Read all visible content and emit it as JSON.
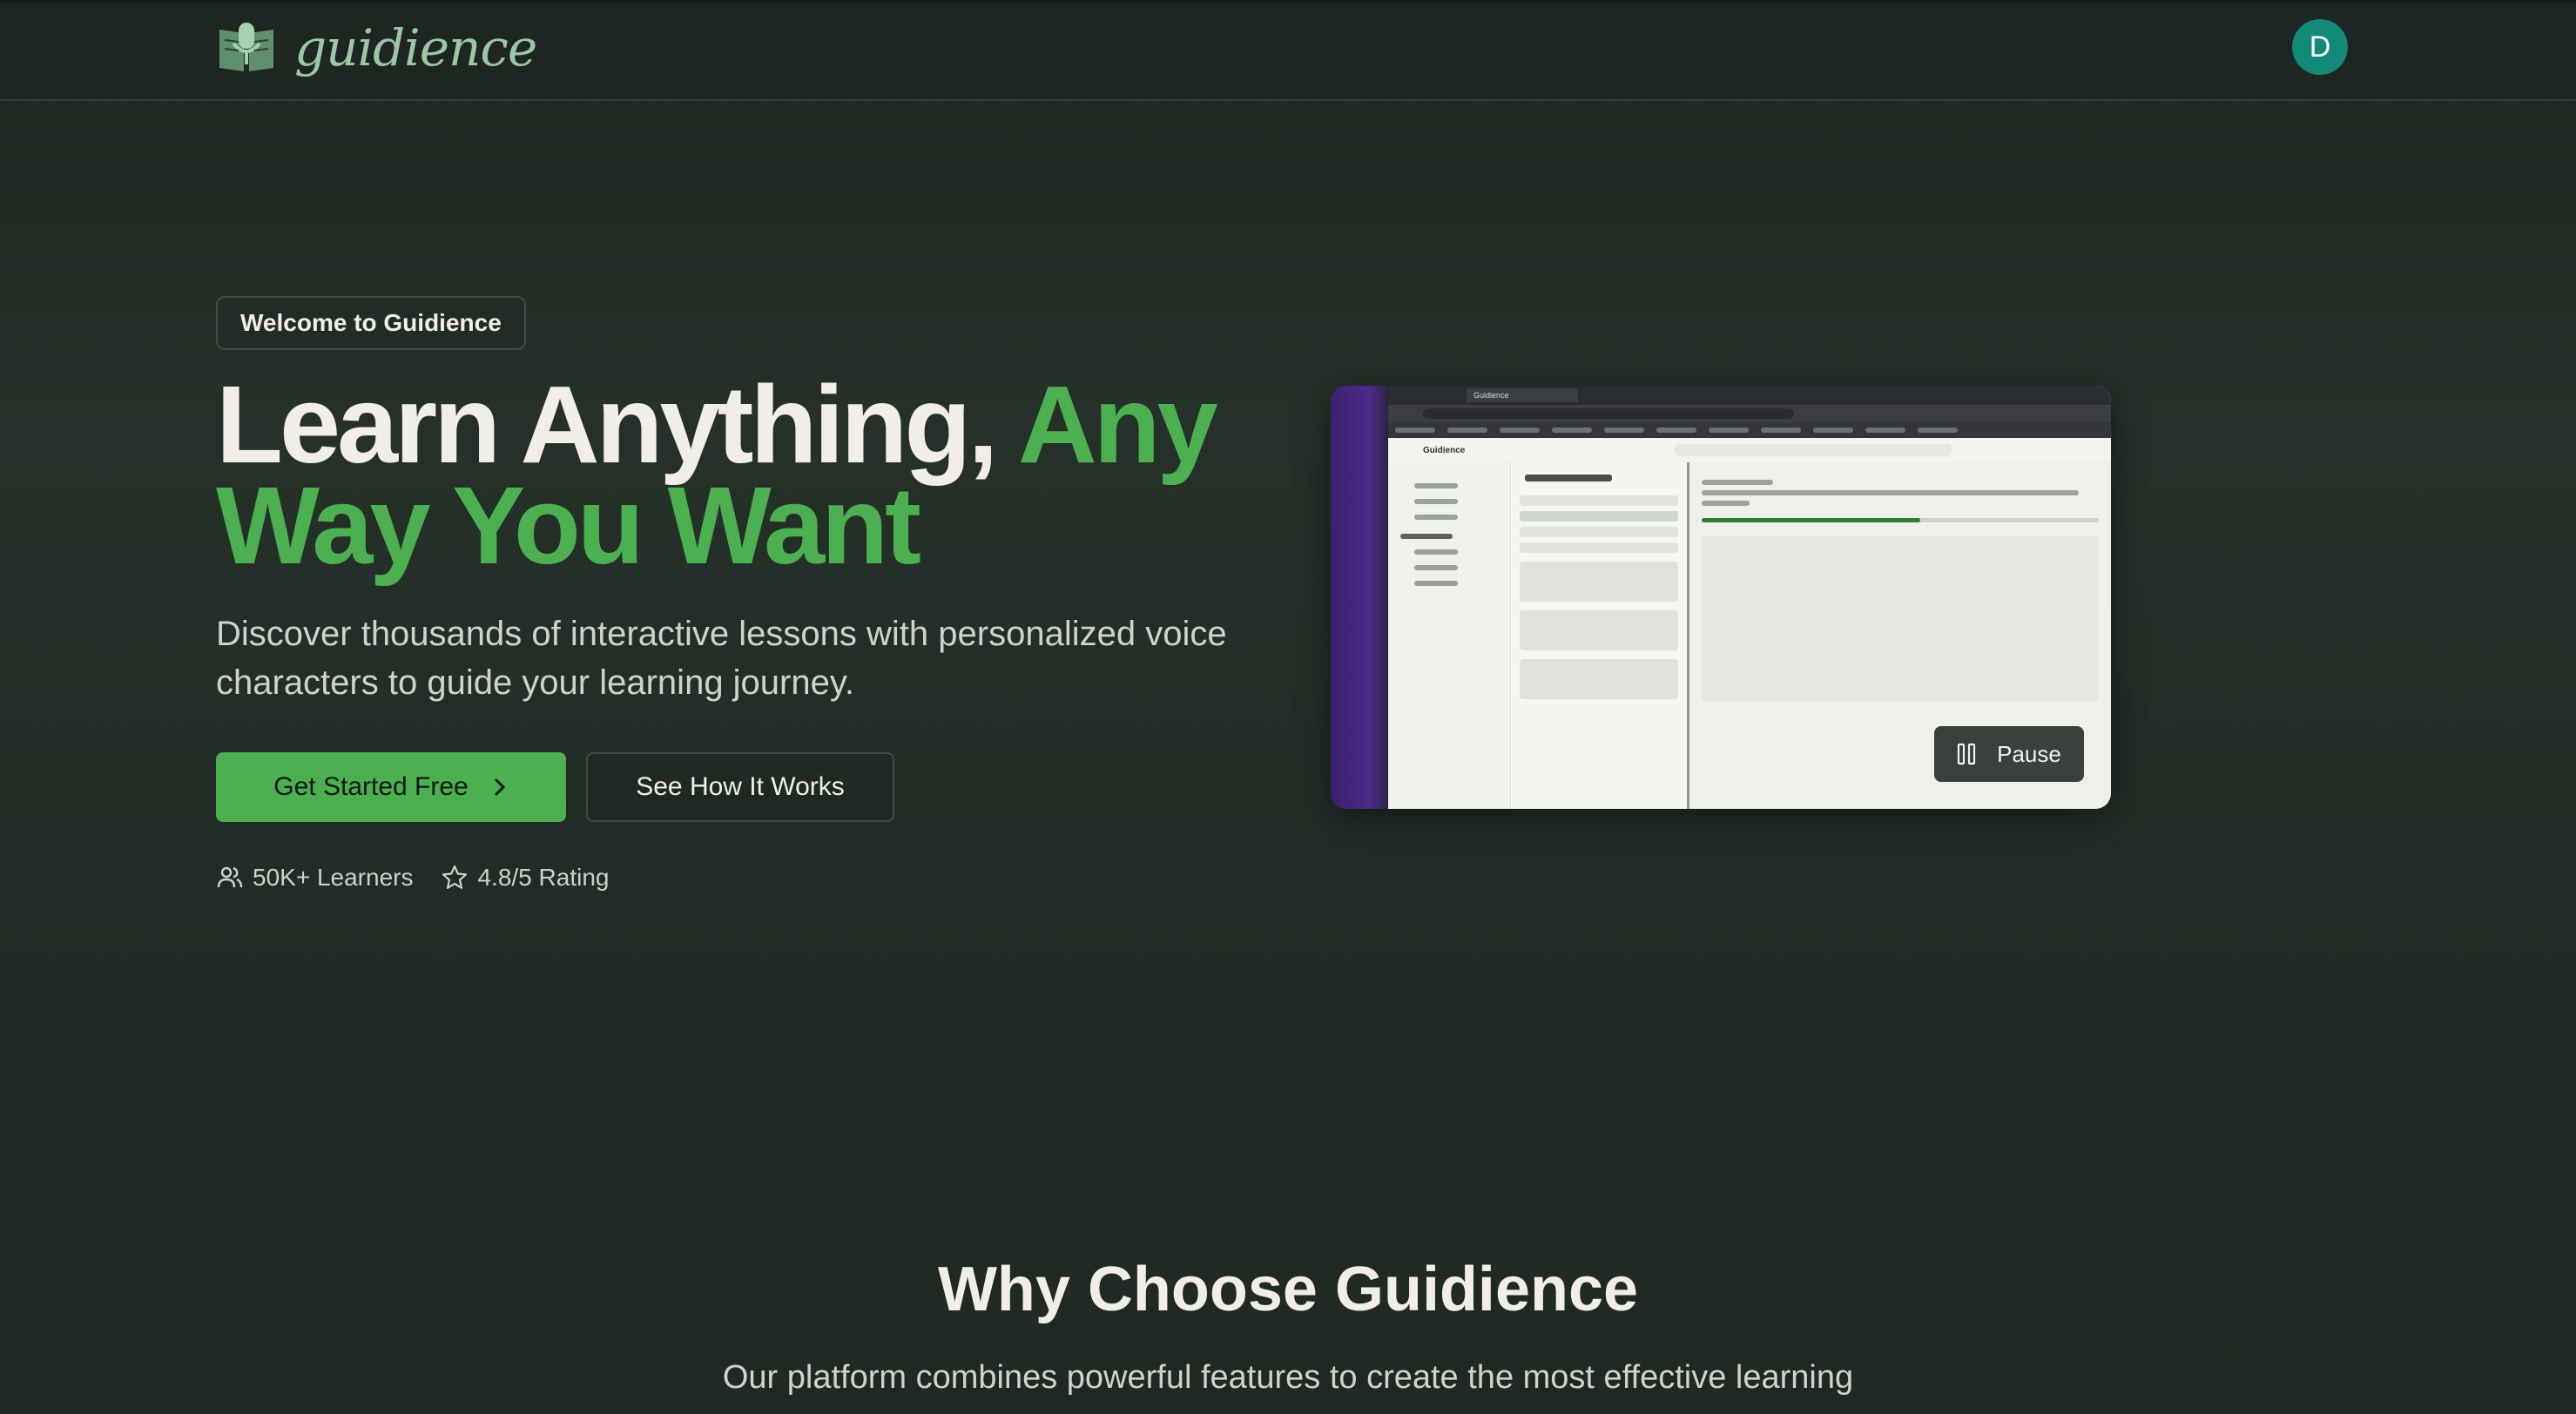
{
  "header": {
    "logo_text": "guidience",
    "avatar_initial": "D"
  },
  "hero": {
    "badge": "Welcome to Guidience",
    "headline_part1": "Learn Anything, ",
    "headline_accent": "Any Way You Want",
    "subtext": "Discover thousands of interactive lessons with personalized voice characters to guide your learning journey.",
    "primary_button": "Get Started Free",
    "secondary_button": "See How It Works",
    "stats": {
      "learners": "50K+ Learners",
      "rating": "4.8/5 Rating"
    }
  },
  "video": {
    "pause_label": "Pause",
    "tab_title": "Guidience",
    "app_title": "Guidience"
  },
  "why": {
    "title": "Why Choose Guidience",
    "subtitle": "Our platform combines powerful features to create the most effective learning"
  },
  "colors": {
    "accent": "#4caf50",
    "background": "#1f2a24",
    "avatar": "#128a78"
  }
}
